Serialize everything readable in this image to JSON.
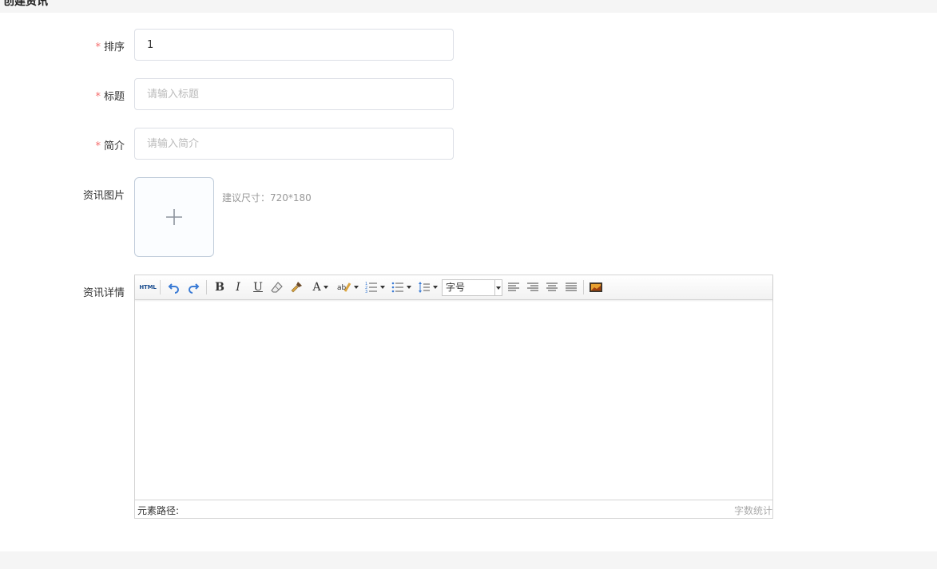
{
  "header": {
    "title": "创建资讯"
  },
  "form": {
    "sort": {
      "label": "排序",
      "required_mark": "*",
      "value": "1"
    },
    "title": {
      "label": "标题",
      "required_mark": "*",
      "placeholder": "请输入标题"
    },
    "intro": {
      "label": "简介",
      "required_mark": "*",
      "placeholder": "请输入简介"
    },
    "image": {
      "label": "资讯图片",
      "hint": "建议尺寸：720*180"
    },
    "detail": {
      "label": "资讯详情"
    }
  },
  "editor": {
    "toolbar": {
      "html_label": "HTML",
      "bold": "B",
      "italic": "I",
      "underline": "U",
      "font_color": "A",
      "fontsize_label": "字号"
    },
    "statusbar": {
      "path_label": "元素路径:",
      "word_count_label": "字数统计"
    }
  },
  "colors": {
    "required": "#f56c6c",
    "border": "#dcdfe6",
    "icon_blue": "#3a7bd5"
  }
}
